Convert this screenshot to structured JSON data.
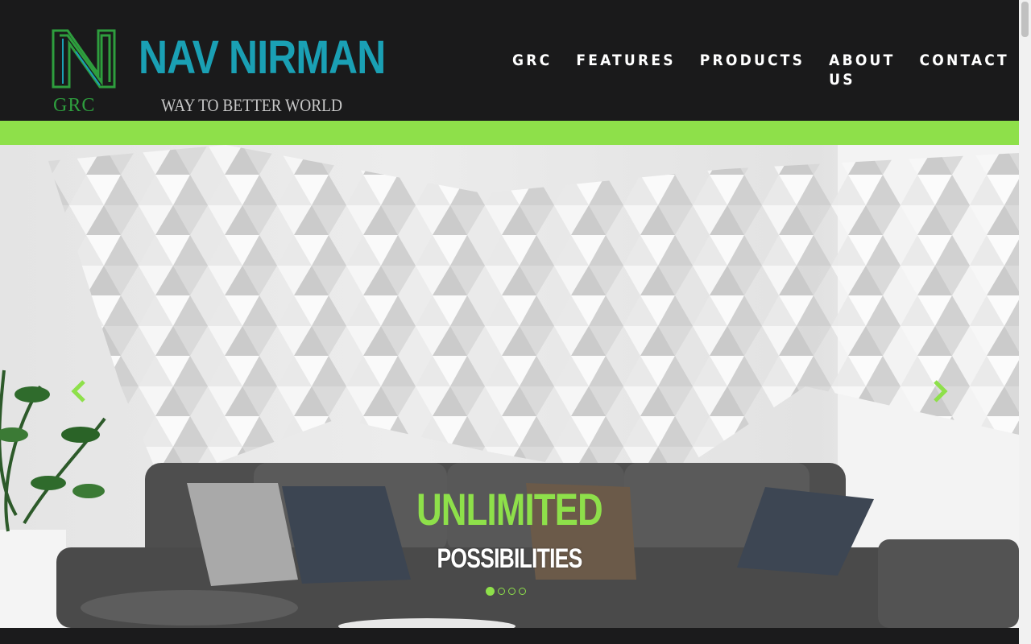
{
  "header": {
    "logo_name": "NAV NIRMAN",
    "logo_grc": "GRC",
    "logo_tagline": "WAY TO BETTER WORLD",
    "nav": [
      "GRC",
      "FEATURES",
      "PRODUCTS",
      "ABOUT US",
      "CONTACT"
    ]
  },
  "slider": {
    "caption_main": "UNLIMITED",
    "caption_sub": "POSSIBILITIES",
    "prev_icon": "chevron-left-icon",
    "next_icon": "chevron-right-icon",
    "slide_count": 4,
    "active_slide": 1
  },
  "colors": {
    "accent_green": "#8ee04a",
    "brand_teal": "#1aa0b4",
    "header_bg": "#1a1a1b"
  }
}
